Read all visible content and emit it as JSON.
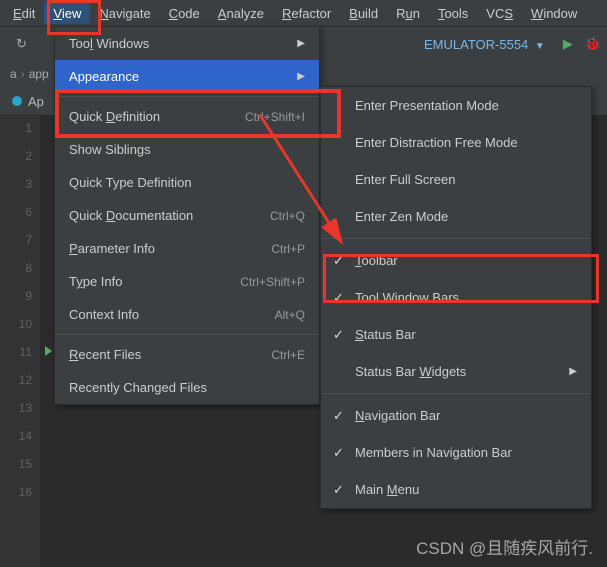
{
  "menubar": [
    "Edit",
    "View",
    "Navigate",
    "Code",
    "Analyze",
    "Refactor",
    "Build",
    "Run",
    "Tools",
    "VCS",
    "Window"
  ],
  "menubar_ul": [
    0,
    0,
    0,
    0,
    0,
    0,
    0,
    1,
    0,
    2,
    0
  ],
  "active_menu_index": 1,
  "toolbar": {
    "emulator": "EMULATOR-5554"
  },
  "breadcrumb": [
    "a",
    "app"
  ],
  "tab": {
    "label": "Ap"
  },
  "line_numbers": [
    1,
    2,
    3,
    6,
    7,
    8,
    9,
    10,
    11,
    12,
    13,
    14,
    15,
    16
  ],
  "run_marker_at": 11,
  "menu1": [
    {
      "label": "Tool Windows",
      "ul": 3,
      "arrow": true
    },
    {
      "label": "Appearance",
      "ul": -1,
      "arrow": true,
      "selected": true
    },
    {
      "sep": true
    },
    {
      "label": "Quick Definition",
      "ul": 6,
      "shortcut": "Ctrl+Shift+I"
    },
    {
      "label": "Show Siblings",
      "ul": -1
    },
    {
      "label": "Quick Type Definition",
      "ul": -1
    },
    {
      "label": "Quick Documentation",
      "ul": 6,
      "shortcut": "Ctrl+Q"
    },
    {
      "label": "Parameter Info",
      "ul": 0,
      "shortcut": "Ctrl+P"
    },
    {
      "label": "Type Info",
      "ul": 1,
      "shortcut": "Ctrl+Shift+P"
    },
    {
      "label": "Context Info",
      "ul": -1,
      "shortcut": "Alt+Q"
    },
    {
      "sep": true
    },
    {
      "label": "Recent Files",
      "ul": 0,
      "shortcut": "Ctrl+E"
    },
    {
      "label": "Recently Changed Files",
      "ul": -1
    }
  ],
  "menu2": [
    {
      "label": "Enter Presentation Mode"
    },
    {
      "label": "Enter Distraction Free Mode"
    },
    {
      "label": "Enter Full Screen"
    },
    {
      "label": "Enter Zen Mode"
    },
    {
      "sep": true
    },
    {
      "label": "Toolbar",
      "ul": 0,
      "chk": true
    },
    {
      "label": "Tool Window Bars",
      "chk": true
    },
    {
      "label": "Status Bar",
      "ul": 0,
      "chk": true
    },
    {
      "label": "Status Bar Widgets",
      "ul": 11,
      "arrow": true
    },
    {
      "sep": true
    },
    {
      "label": "Navigation Bar",
      "ul": 0,
      "chk": true
    },
    {
      "label": "Members in Navigation Bar",
      "chk": true
    },
    {
      "label": "Main Menu",
      "ul": 5,
      "chk": true
    }
  ],
  "watermark": "CSDN @且随疾风前行."
}
